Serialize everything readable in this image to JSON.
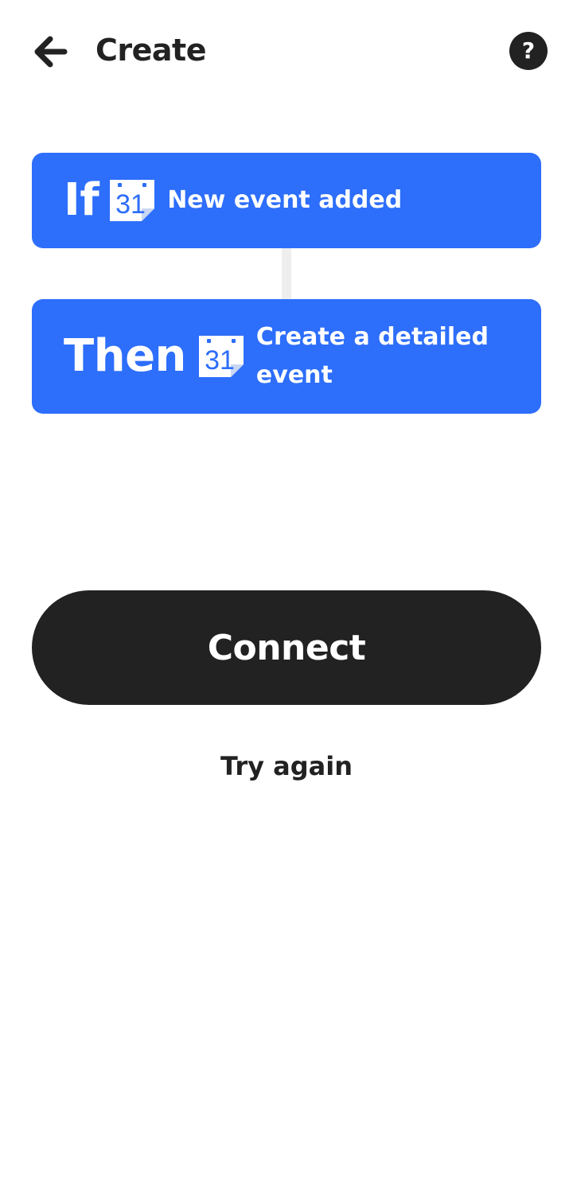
{
  "header": {
    "title": "Create",
    "back_icon": "arrow-left-icon",
    "help_icon": "question-mark-icon",
    "help_glyph": "?"
  },
  "trigger": {
    "keyword": "If",
    "service_icon": "google-calendar-icon",
    "calendar_day": "31",
    "text": "New event added"
  },
  "action": {
    "keyword": "Then",
    "service_icon": "google-calendar-icon",
    "calendar_day": "31",
    "text": "Create a detailed event"
  },
  "connect_button": {
    "label": "Connect"
  },
  "try_again": {
    "label": "Try again"
  },
  "colors": {
    "card_blue": "#2d6efb",
    "dark": "#222222",
    "connector": "#eeeeee",
    "background": "#ffffff"
  }
}
